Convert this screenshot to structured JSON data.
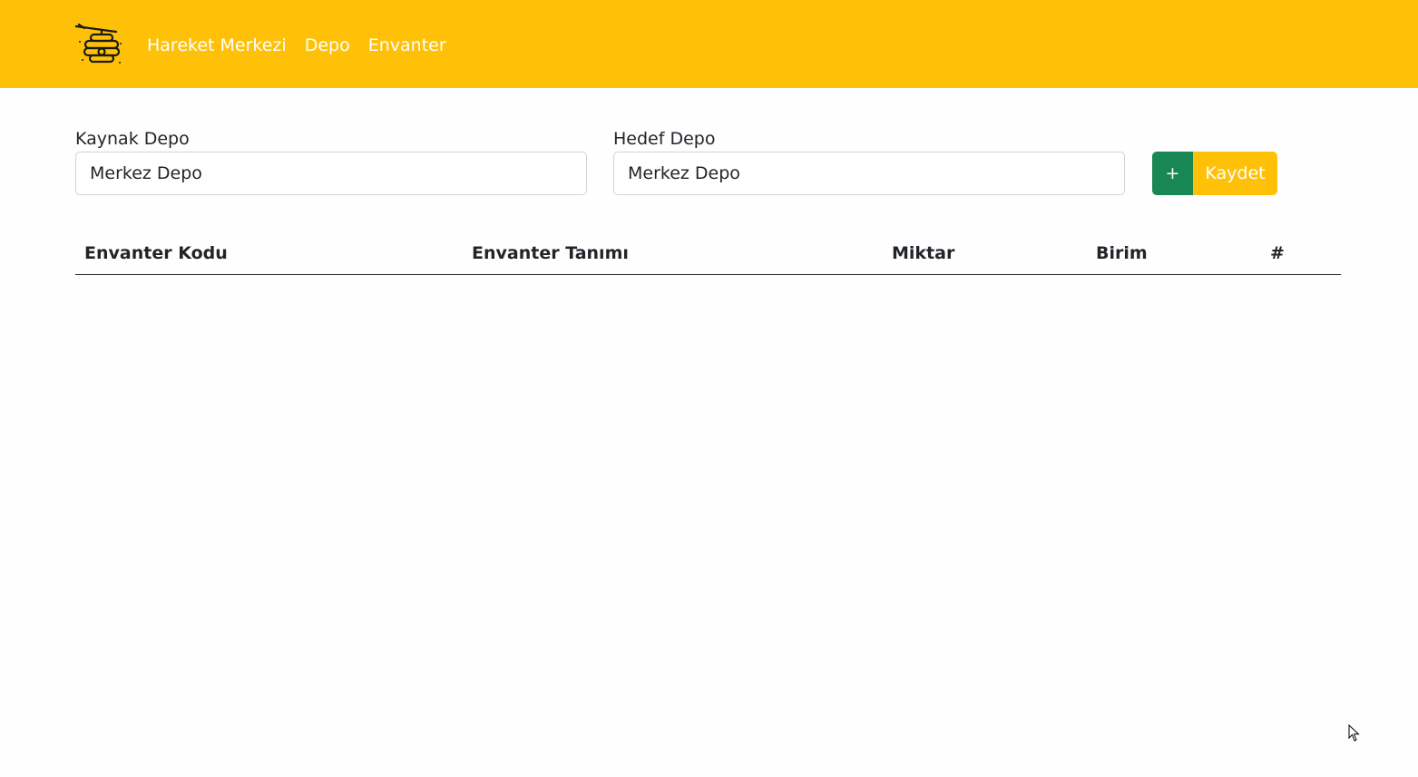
{
  "navbar": {
    "logo": "beehive-icon",
    "links": [
      {
        "label": "Hareket Merkezi"
      },
      {
        "label": "Depo"
      },
      {
        "label": "Envanter"
      }
    ],
    "background": "#ffc107"
  },
  "form": {
    "source": {
      "label": "Kaynak Depo",
      "value": "Merkez Depo"
    },
    "target": {
      "label": "Hedef Depo",
      "value": "Merkez Depo"
    },
    "add_label": "+",
    "save_label": "Kaydet"
  },
  "table": {
    "columns": [
      "Envanter Kodu",
      "Envanter Tanımı",
      "Miktar",
      "Birim",
      "#"
    ],
    "rows": []
  },
  "colors": {
    "accent": "#ffc107",
    "success": "#198754"
  }
}
